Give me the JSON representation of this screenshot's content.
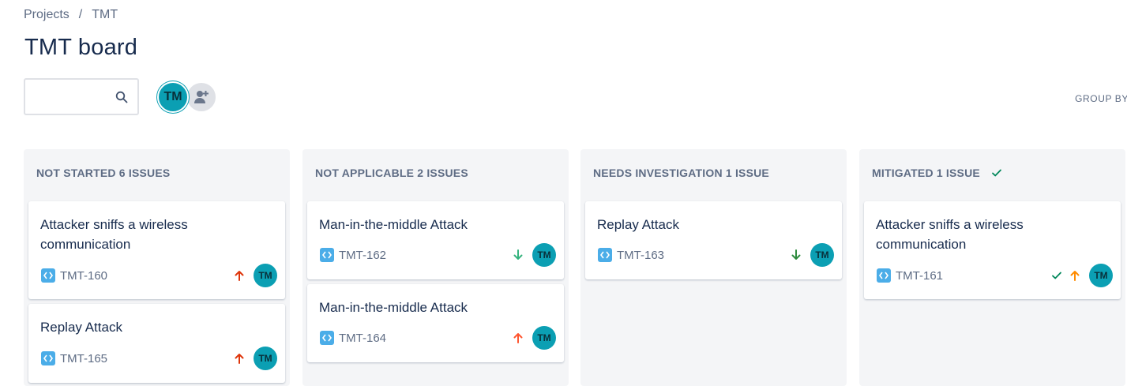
{
  "breadcrumb": {
    "projects": "Projects",
    "separator": "/",
    "project": "TMT"
  },
  "page_title": "TMT board",
  "search": {
    "value": "",
    "placeholder": "",
    "icon": "search-icon"
  },
  "avatars": {
    "user_initials": "TM",
    "add_icon": "add-person-icon"
  },
  "group_by": "GROUP BY",
  "colors": {
    "avatar": "#0b9fb3",
    "priority_high": "#de350b",
    "priority_low": "#36b37e",
    "priority_medium": "#ff8b00",
    "done_check": "#00875a",
    "type_icon": "#4bade8"
  },
  "columns": [
    {
      "header": "NOT STARTED 6 ISSUES",
      "cards": [
        {
          "title": "Attacker sniffs a wireless communication",
          "key": "TMT-160",
          "priority": "high",
          "assignee": "TM"
        },
        {
          "title": "Replay Attack",
          "key": "TMT-165",
          "priority": "high",
          "assignee": "TM"
        }
      ]
    },
    {
      "header": "NOT APPLICABLE 2 ISSUES",
      "cards": [
        {
          "title": "Man-in-the-middle Attack",
          "key": "TMT-162",
          "priority": "low",
          "assignee": "TM"
        },
        {
          "title": "Man-in-the-middle Attack",
          "key": "TMT-164",
          "priority": "high",
          "assignee": "TM"
        }
      ]
    },
    {
      "header": "NEEDS INVESTIGATION 1 ISSUE",
      "cards": [
        {
          "title": "Replay Attack",
          "key": "TMT-163",
          "priority": "low",
          "assignee": "TM"
        }
      ]
    },
    {
      "header": "MITIGATED 1 ISSUE",
      "header_icon": "check-icon",
      "cards": [
        {
          "title": "Attacker sniffs a wireless communication",
          "key": "TMT-161",
          "priority": "medium",
          "done": true,
          "assignee": "TM"
        }
      ]
    }
  ]
}
